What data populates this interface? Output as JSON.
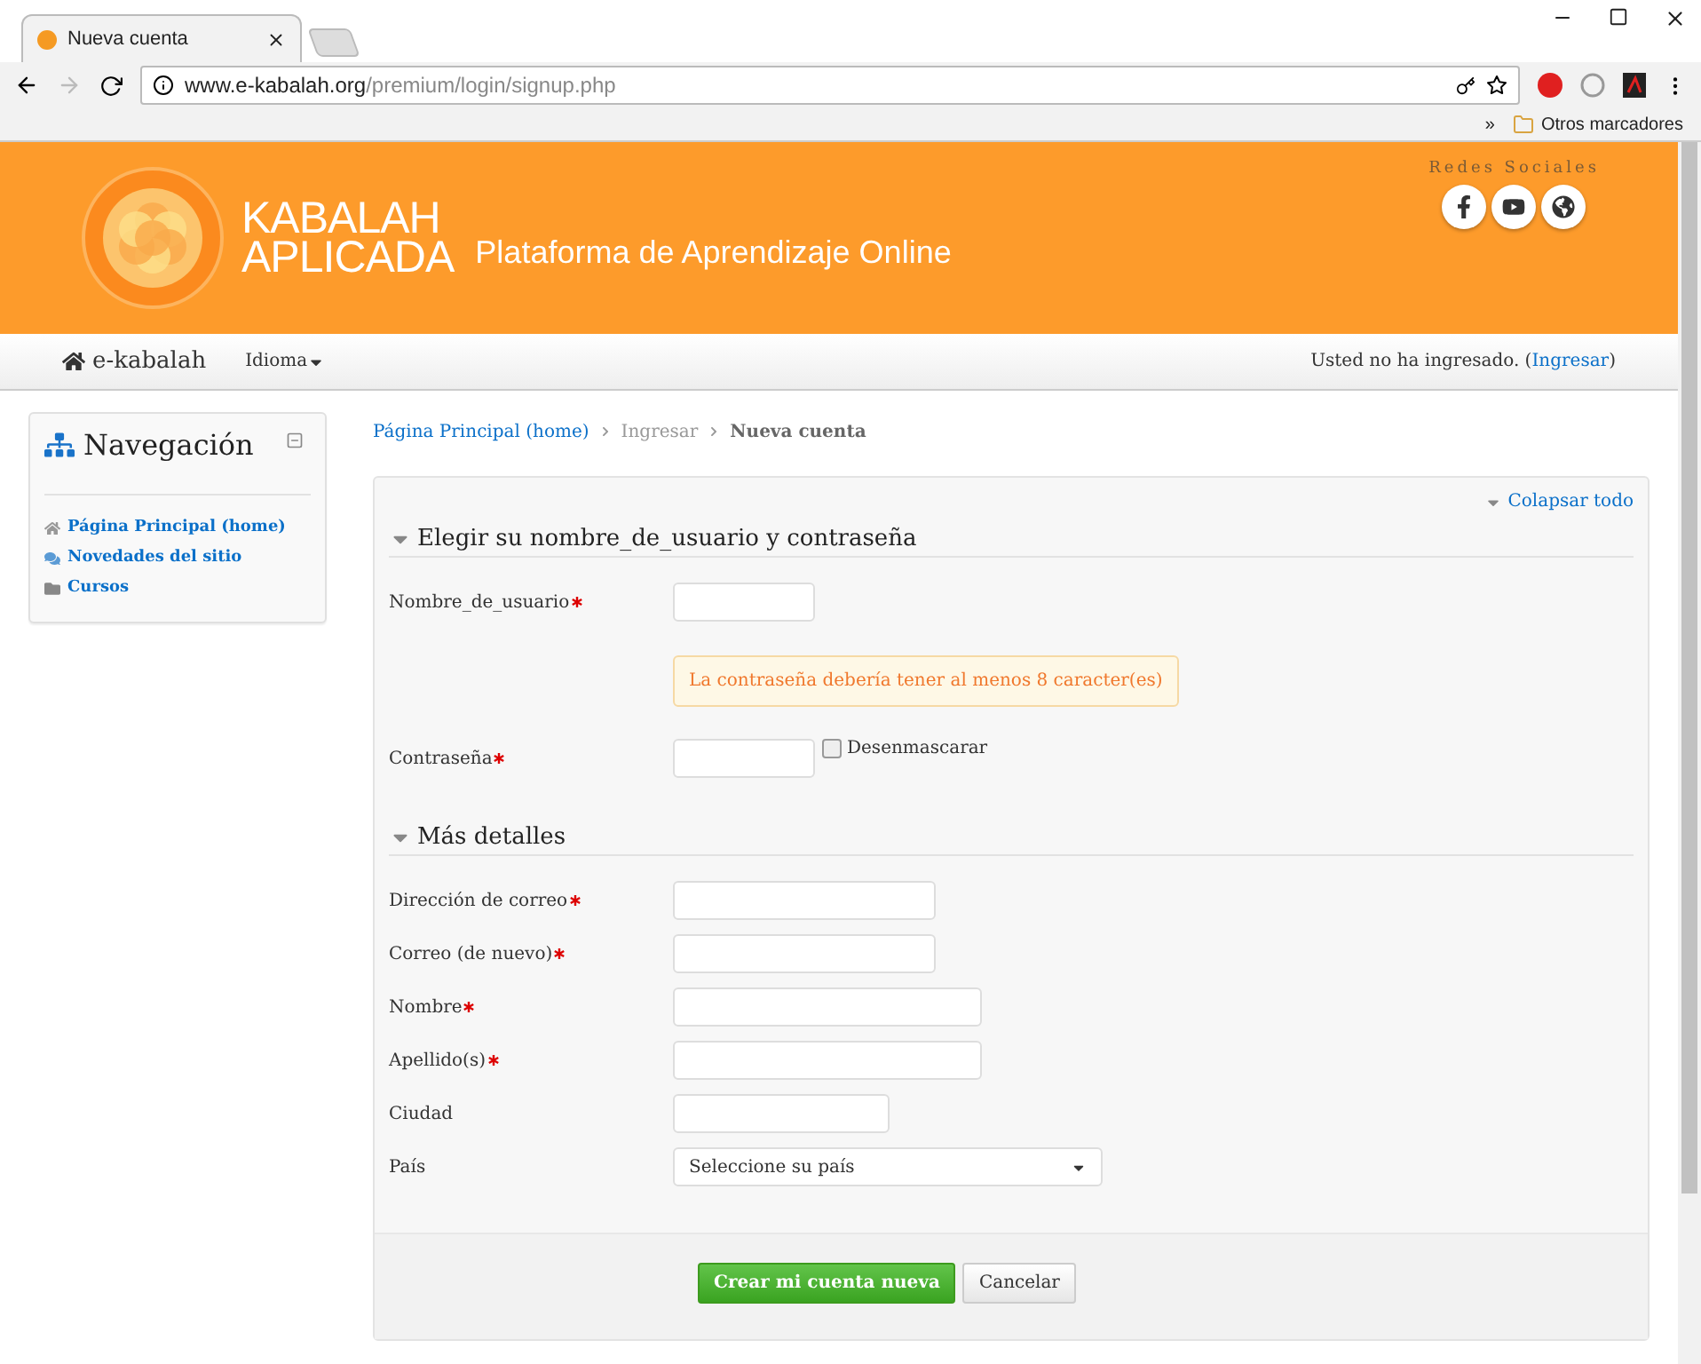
{
  "browser": {
    "tab_title": "Nueva cuenta",
    "url_host": "www.e-kabalah.org",
    "url_path": "/premium/login/signup.php",
    "overflow": "»",
    "bookmark_folder": "Otros marcadores"
  },
  "header": {
    "logo_line1": "KABALAH",
    "logo_line2": "APLICADA",
    "tagline": "Plataforma de Aprendizaje Online",
    "social_title": "Redes Sociales"
  },
  "navbar": {
    "brand": "e-kabalah",
    "menu": "Idioma",
    "login_prefix": "Usted no ha ingresado. (",
    "login_link": "Ingresar",
    "login_suffix": ")"
  },
  "sidebar": {
    "title": "Navegación",
    "items": [
      {
        "label": "Página Principal (home)",
        "kind": "home"
      },
      {
        "label": "Novedades del sitio",
        "kind": "news"
      },
      {
        "label": "Cursos",
        "kind": "folder"
      }
    ]
  },
  "breadcrumb": [
    {
      "label": "Página Principal (home)",
      "kind": "link"
    },
    {
      "label": "Ingresar",
      "kind": "plain"
    },
    {
      "label": "Nueva cuenta",
      "kind": "current"
    }
  ],
  "form": {
    "collapse_all": "Colapsar todo",
    "sections": [
      {
        "title": "Elegir su nombre_de_usuario y contraseña",
        "expanded": true,
        "fields": [
          {
            "kind": "text",
            "label": "Nombre_de_usuario",
            "required": true
          },
          {
            "kind": "note",
            "text": "La contraseña debería tener al menos 8 caracter(es)"
          },
          {
            "kind": "password",
            "label": "Contraseña",
            "required": true,
            "unmask_label": "Desenmascarar",
            "unmask_checked": false
          }
        ]
      },
      {
        "title": "Más detalles",
        "expanded": true,
        "fields": [
          {
            "kind": "text",
            "label": "Dirección de correo",
            "required": true
          },
          {
            "kind": "text",
            "label": "Correo (de nuevo)",
            "required": true
          },
          {
            "kind": "text",
            "label": "Nombre",
            "required": true
          },
          {
            "kind": "text",
            "label": "Apellido(s)",
            "required": true
          },
          {
            "kind": "text",
            "label": "Ciudad",
            "required": false
          },
          {
            "kind": "select",
            "label": "País",
            "required": false,
            "value": "Seleccione su país"
          }
        ]
      }
    ],
    "buttons": [
      {
        "label": "Crear mi cuenta nueva",
        "kind": "primary"
      },
      {
        "label": "Cancelar",
        "kind": "default"
      }
    ]
  }
}
